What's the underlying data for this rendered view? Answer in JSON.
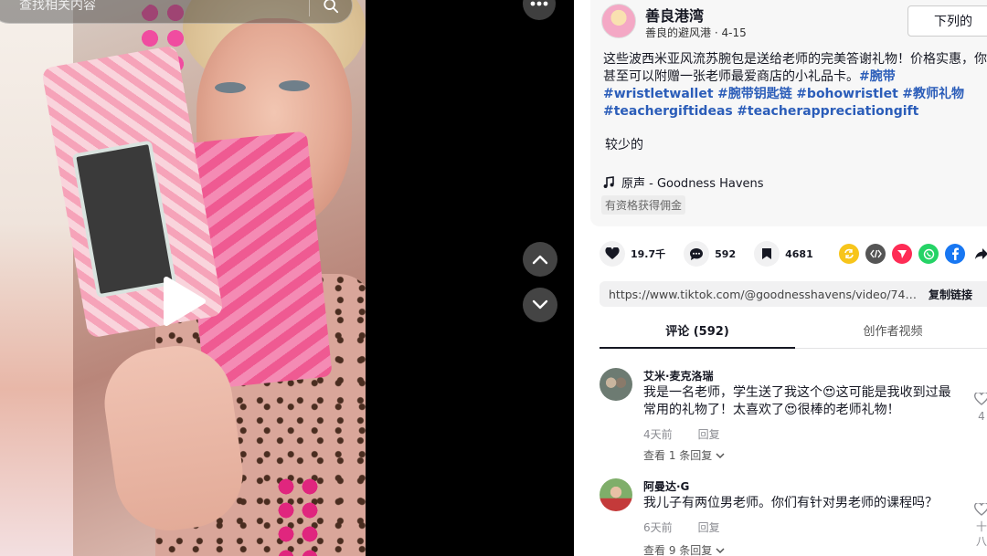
{
  "search": {
    "placeholder": "查找相关内容"
  },
  "video": {
    "state": "paused"
  },
  "author": {
    "name": "善良港湾",
    "handle": "善良的避风港",
    "date": "4-15",
    "follow_label": "下列的"
  },
  "description": {
    "text": "这些波西米亚风流苏腕包是送给老师的完美答谢礼物！价格实惠，你甚至可以附赠一张老师最爱商店的小礼品卡。",
    "hashtags": [
      "#腕带",
      "#wristletwallet",
      "#腕带钥匙链",
      "#bohowristlet",
      "#教师礼物",
      "#teachergiftideas",
      "#teacherappreciationgift"
    ],
    "less_label": "较少的",
    "music": "原声 - Goodness Havens",
    "eligible_label": "有资格获得佣金"
  },
  "actions": {
    "likes": "19.7千",
    "comments": "592",
    "saves": "4681",
    "share_icons": [
      "repost-icon",
      "embed-icon",
      "send-icon",
      "whatsapp-icon",
      "facebook-icon",
      "share-arrow-icon"
    ]
  },
  "link": {
    "url": "https://www.tiktok.com/@goodnesshavens/video/7493...",
    "copy_label": "复制链接"
  },
  "tabs": [
    {
      "label": "评论 (592)",
      "active": true
    },
    {
      "label": "创作者视频",
      "active": false
    }
  ],
  "comments": [
    {
      "name": "艾米·麦克洛瑞",
      "text_parts": [
        "我是一名老师，学生送了我这个",
        "这可能是我收到过最常用的礼物了！太喜欢了",
        "很棒的老师礼物！"
      ],
      "time": "4天前",
      "reply_label": "回复",
      "more_label": "查看 1 条回复",
      "like_count": "4"
    },
    {
      "name": "阿曼达·G",
      "text": "我儿子有两位男老师。你们有针对男老师的课程吗？",
      "time": "6天前",
      "reply_label": "回复",
      "more_label": "查看 9 条回复",
      "like_count": "十八"
    }
  ],
  "colors": {
    "hashtag": "#2b5db9",
    "text": "#161823",
    "muted": "#8a8b91"
  }
}
